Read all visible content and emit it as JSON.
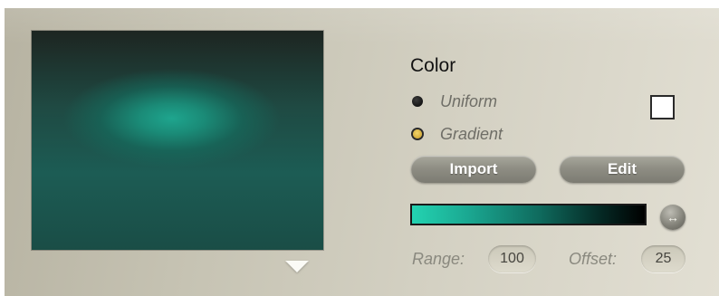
{
  "color_panel": {
    "title": "Color",
    "options": [
      {
        "label": "Uniform",
        "selected": false
      },
      {
        "label": "Gradient",
        "selected": true
      }
    ],
    "uniform_swatch_color": "#ffffff",
    "buttons": {
      "import_label": "Import",
      "edit_label": "Edit"
    },
    "gradient": {
      "start_color": "#23d3b1",
      "end_color": "#000000"
    },
    "swap_icon": "↔",
    "range": {
      "label": "Range:",
      "value": "100"
    },
    "offset": {
      "label": "Offset:",
      "value": "25"
    }
  },
  "preview": {
    "background_color": "#1c5c54",
    "highlight_color": "#1ea58e"
  },
  "accent_colors": {
    "radio_selected": "#e0b840",
    "button": "#8f8e84",
    "panel": "#cdcabb"
  }
}
